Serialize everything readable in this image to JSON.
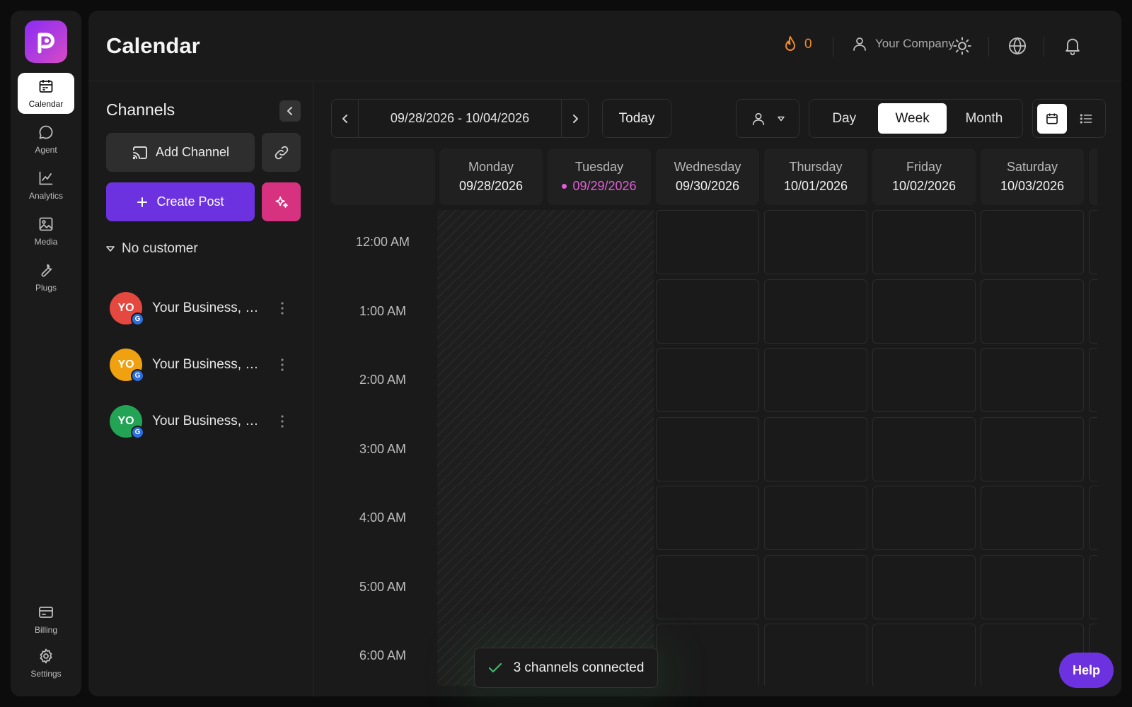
{
  "nav": {
    "items": [
      {
        "label": "Calendar",
        "icon": "calendar-icon",
        "active": true
      },
      {
        "label": "Agent",
        "icon": "chat-bubble-icon"
      },
      {
        "label": "Analytics",
        "icon": "line-chart-icon"
      },
      {
        "label": "Media",
        "icon": "image-icon"
      },
      {
        "label": "Plugs",
        "icon": "wrench-icon"
      }
    ],
    "bottom": [
      {
        "label": "Billing",
        "icon": "credit-card-icon"
      },
      {
        "label": "Settings",
        "icon": "gear-icon"
      }
    ]
  },
  "header": {
    "title": "Calendar",
    "streak_count": "0",
    "company": "Your Company"
  },
  "channels": {
    "title": "Channels",
    "add_channel": "Add Channel",
    "create_post": "Create Post",
    "customer": "No customer",
    "items": [
      {
        "initials": "YO",
        "name": "Your Business, LLC",
        "color": "#e5483f",
        "badge": "G"
      },
      {
        "initials": "YO",
        "name": "Your Business, LLC",
        "color": "#f0a10f",
        "badge": "G"
      },
      {
        "initials": "YO",
        "name": "Your Business, LLC",
        "color": "#23a455",
        "badge": "G"
      }
    ]
  },
  "calendar": {
    "date_range": "09/28/2026 - 10/04/2026",
    "today_label": "Today",
    "views": [
      "Day",
      "Week",
      "Month"
    ],
    "active_view": "Week",
    "days": [
      {
        "name": "Monday",
        "date": "09/28/2026"
      },
      {
        "name": "Tuesday",
        "date": "09/29/2026",
        "today": true
      },
      {
        "name": "Wednesday",
        "date": "09/30/2026"
      },
      {
        "name": "Thursday",
        "date": "10/01/2026"
      },
      {
        "name": "Friday",
        "date": "10/02/2026"
      },
      {
        "name": "Saturday",
        "date": "10/03/2026"
      }
    ],
    "times": [
      "12:00 AM",
      "1:00 AM",
      "2:00 AM",
      "3:00 AM",
      "4:00 AM",
      "5:00 AM",
      "6:00 AM"
    ]
  },
  "toast": {
    "text": "3 channels connected"
  },
  "help": {
    "label": "Help"
  },
  "colors": {
    "accent": "#6d32e0",
    "magic": "#d7327f",
    "today": "#e15ed7",
    "streak": "#f08a2c"
  }
}
